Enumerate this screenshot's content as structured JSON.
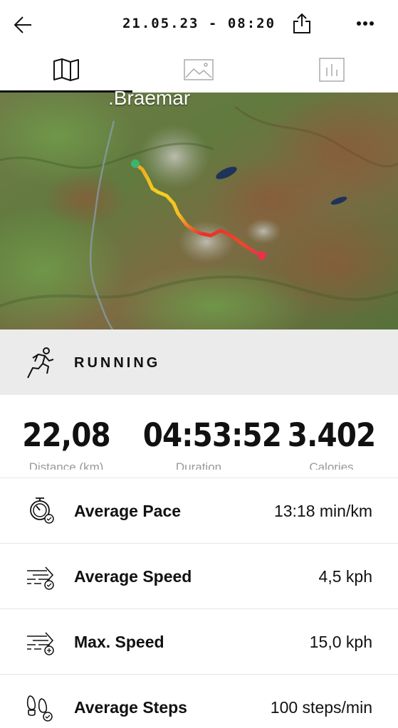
{
  "header": {
    "title": "21.05.23 - 08:20",
    "back_icon": "arrow-left-icon",
    "share_icon": "share-icon",
    "more_icon": "more-horizontal-icon"
  },
  "tabs": [
    {
      "name": "map",
      "icon": "map-icon",
      "selected": true
    },
    {
      "name": "photos",
      "icon": "image-icon",
      "selected": false
    },
    {
      "name": "stats",
      "icon": "bar-chart-icon",
      "selected": false
    }
  ],
  "map": {
    "place_label": ".Braemar",
    "route_start_color": "#3db36b",
    "route_end_color": "#e8334a"
  },
  "activity": {
    "label": "RUNNING",
    "icon": "running-person-icon"
  },
  "summary": {
    "distance": "22,08",
    "duration": "04:53:52",
    "calories": "3.402",
    "distance_label": "Distance (km)",
    "duration_label": "Duration",
    "calories_label": "Calories"
  },
  "metrics": [
    {
      "label": "Average Pace",
      "value": "13:18 min/km",
      "icon": "stopwatch-icon"
    },
    {
      "label": "Average Speed",
      "value": "4,5 kph",
      "icon": "speed-arrow-icon"
    },
    {
      "label": "Max. Speed",
      "value": "15,0 kph",
      "icon": "max-speed-icon"
    },
    {
      "label": "Average Steps",
      "value": "100 steps/min",
      "icon": "footsteps-icon"
    }
  ],
  "colors": {
    "accent_dark": "#111111",
    "activity_bar_bg": "#ebebeb"
  }
}
